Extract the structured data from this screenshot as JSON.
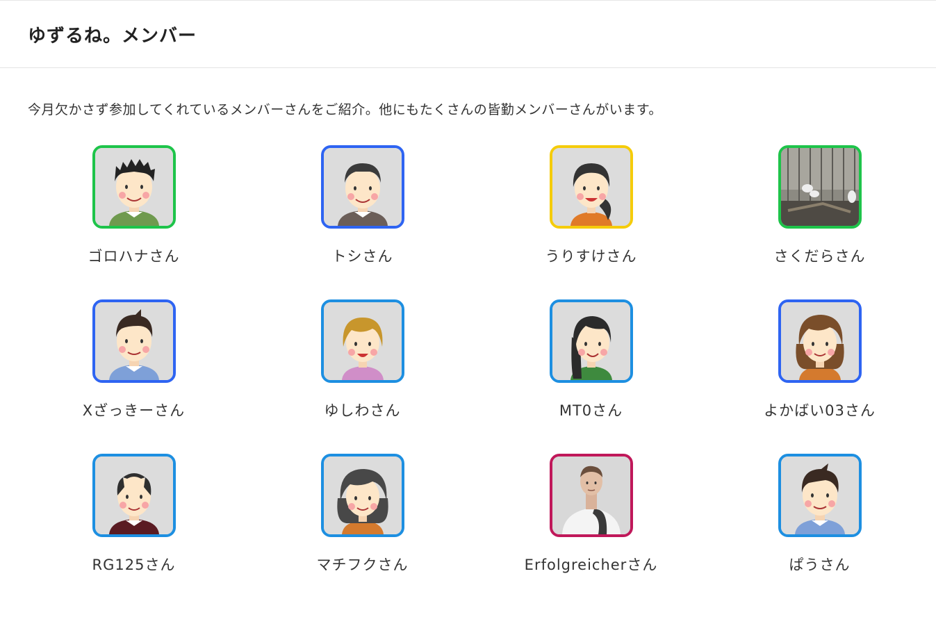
{
  "header": {
    "title": "ゆずるね。メンバー"
  },
  "intro": "今月欠かさず参加してくれているメンバーさんをご紹介。他にもたくさんの皆勤メンバーさんがいます。",
  "colors": {
    "green": "#1ec44a",
    "blue": "#2e64f2",
    "yellow": "#f5cc0b",
    "skyblue": "#1d8fe1",
    "magenta": "#c0185a"
  },
  "members": [
    {
      "name": "ゴロハナさん",
      "border": "#1ec44a",
      "avatar": "boy-spiky-hair-green-shirt-icon"
    },
    {
      "name": "トシさん",
      "border": "#2e64f2",
      "avatar": "older-man-brown-sweater-icon"
    },
    {
      "name": "うりすけさん",
      "border": "#f5cc0b",
      "avatar": "woman-ponytail-orange-shirt-icon"
    },
    {
      "name": "さくだらさん",
      "border": "#1ec44a",
      "avatar": "photo-birds-in-cage-icon"
    },
    {
      "name": "Xざっきーさん",
      "border": "#2e64f2",
      "avatar": "man-blue-shirt-icon"
    },
    {
      "name": "ゆしわさん",
      "border": "#1d8fe1",
      "avatar": "blonde-person-pink-shirt-icon"
    },
    {
      "name": "MT0さん",
      "border": "#1d8fe1",
      "avatar": "woman-long-dark-hair-green-shirt-icon"
    },
    {
      "name": "よかばい03さん",
      "border": "#2e64f2",
      "avatar": "woman-brown-hair-orange-shirt-icon"
    },
    {
      "name": "RG125さん",
      "border": "#1d8fe1",
      "avatar": "balding-man-maroon-sweater-icon"
    },
    {
      "name": "マチフクさん",
      "border": "#1d8fe1",
      "avatar": "woman-bob-hair-orange-shirt-icon"
    },
    {
      "name": "Erfolgreicherさん",
      "border": "#c0185a",
      "avatar": "photo-man-white-shirt-icon"
    },
    {
      "name": "ぱうさん",
      "border": "#1d8fe1",
      "avatar": "young-man-blue-shirt-icon"
    }
  ]
}
